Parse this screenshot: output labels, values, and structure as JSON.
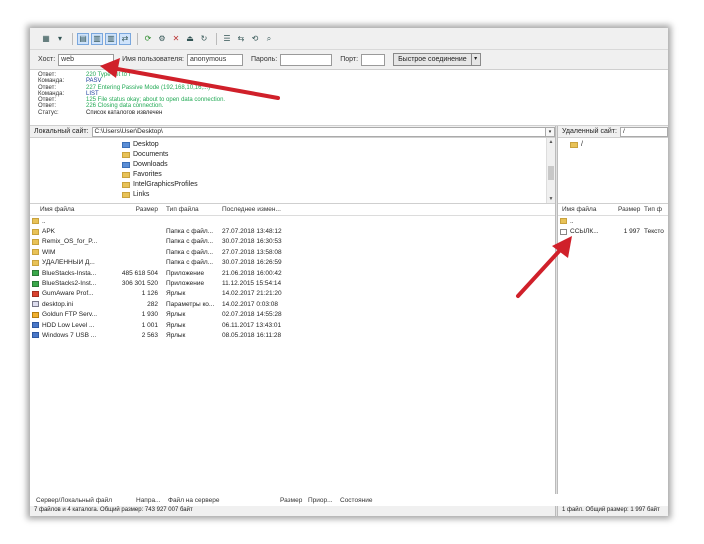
{
  "quickconnect": {
    "host_label": "Хост:",
    "host_value": "web",
    "user_label": "Имя пользователя:",
    "user_value": "anonymous",
    "pass_label": "Пароль:",
    "pass_value": "",
    "port_label": "Порт:",
    "port_value": "",
    "connect_label": "Быстрое соединение"
  },
  "log": [
    {
      "type": "Ответ:",
      "msg": "220 Type set to I",
      "kind": "resp"
    },
    {
      "type": "Команда:",
      "msg": "PASV",
      "kind": "cmd"
    },
    {
      "type": "Ответ:",
      "msg": "227 Entering Passive Mode (192,168,10,16,...)",
      "kind": "resp"
    },
    {
      "type": "Команда:",
      "msg": "LIST",
      "kind": "cmd"
    },
    {
      "type": "Ответ:",
      "msg": "125 File status okay; about to open data connection.",
      "kind": "resp"
    },
    {
      "type": "Ответ:",
      "msg": "226 Closing data connection.",
      "kind": "resp"
    },
    {
      "type": "Статус:",
      "msg": "Список каталогов извлечен",
      "kind": "plain"
    }
  ],
  "local": {
    "site_label": "Локальный сайт:",
    "site_path": "C:\\Users\\User\\Desktop\\",
    "tree": [
      {
        "name": "Desktop",
        "icon": "blue"
      },
      {
        "name": "Documents",
        "icon": "yellow"
      },
      {
        "name": "Downloads",
        "icon": "blue"
      },
      {
        "name": "Favorites",
        "icon": "yellow"
      },
      {
        "name": "IntelGraphicsProfiles",
        "icon": "yellow"
      },
      {
        "name": "Links",
        "icon": "yellow"
      }
    ],
    "columns": [
      "Имя файла",
      "Размер",
      "Тип файла",
      "Последнее измен..."
    ],
    "files": [
      {
        "name": "..",
        "size": "",
        "type": "",
        "date": "",
        "icon": "folder"
      },
      {
        "name": "APK",
        "size": "",
        "type": "Папка с файл...",
        "date": "27.07.2018 13:48:12",
        "icon": "folder"
      },
      {
        "name": "Remix_OS_for_P...",
        "size": "",
        "type": "Папка с файл...",
        "date": "30.07.2018 16:30:53",
        "icon": "folder"
      },
      {
        "name": "WIM",
        "size": "",
        "type": "Папка с файл...",
        "date": "27.07.2018 13:58:08",
        "icon": "folder"
      },
      {
        "name": "УДАЛЕННЫЙ Д...",
        "size": "",
        "type": "Папка с файл...",
        "date": "30.07.2018 16:26:59",
        "icon": "folder"
      },
      {
        "name": "BlueStacks-Insta...",
        "size": "485 618 504",
        "type": "Приложение",
        "date": "21.06.2018 16:00:42",
        "icon": "app"
      },
      {
        "name": "BlueStacks2-Inst...",
        "size": "306 301 520",
        "type": "Приложение",
        "date": "11.12.2015 15:54:14",
        "icon": "app"
      },
      {
        "name": "GumAware Prof...",
        "size": "1 126",
        "type": "Ярлык",
        "date": "14.02.2017 21:21:20",
        "icon": "red"
      },
      {
        "name": "desktop.ini",
        "size": "282",
        "type": "Параметры кo...",
        "date": "14.02.2017 0:03:08",
        "icon": "ini"
      },
      {
        "name": "Goldun FTP Serv...",
        "size": "1 930",
        "type": "Ярлык",
        "date": "02.07.2018 14:55:28",
        "icon": "gold"
      },
      {
        "name": "HDD Low Level ...",
        "size": "1 001",
        "type": "Ярлык",
        "date": "06.11.2017 13:43:01",
        "icon": "lnk"
      },
      {
        "name": "Windows 7 USB ...",
        "size": "2 563",
        "type": "Ярлык",
        "date": "08.05.2018 16:11:28",
        "icon": "lnk"
      }
    ],
    "status": "7 файлов и 4 каталога. Общий размер: 743 927 007 байт"
  },
  "remote": {
    "site_label": "Удаленный сайт:",
    "site_path": "/",
    "tree": [
      {
        "name": "/",
        "icon": "yellow"
      }
    ],
    "columns": [
      "Имя файла",
      "Размер",
      "Тип ф"
    ],
    "files": [
      {
        "name": "..",
        "size": "",
        "type": "",
        "icon": "folder"
      },
      {
        "name": "ССЫЛК...",
        "size": "1 997",
        "type": "Тексто",
        "icon": "file"
      }
    ],
    "status": "1 файл. Общий размер: 1 997 байт"
  },
  "queue": {
    "columns": [
      "Сервер/Локальный файл",
      "Напра...",
      "Файл на сервере",
      "Размер",
      "Приор...",
      "Состояние"
    ]
  },
  "colors": {
    "arrow": "#d0202a",
    "log_response": "#22aa55",
    "log_command": "#1a3c9c"
  }
}
